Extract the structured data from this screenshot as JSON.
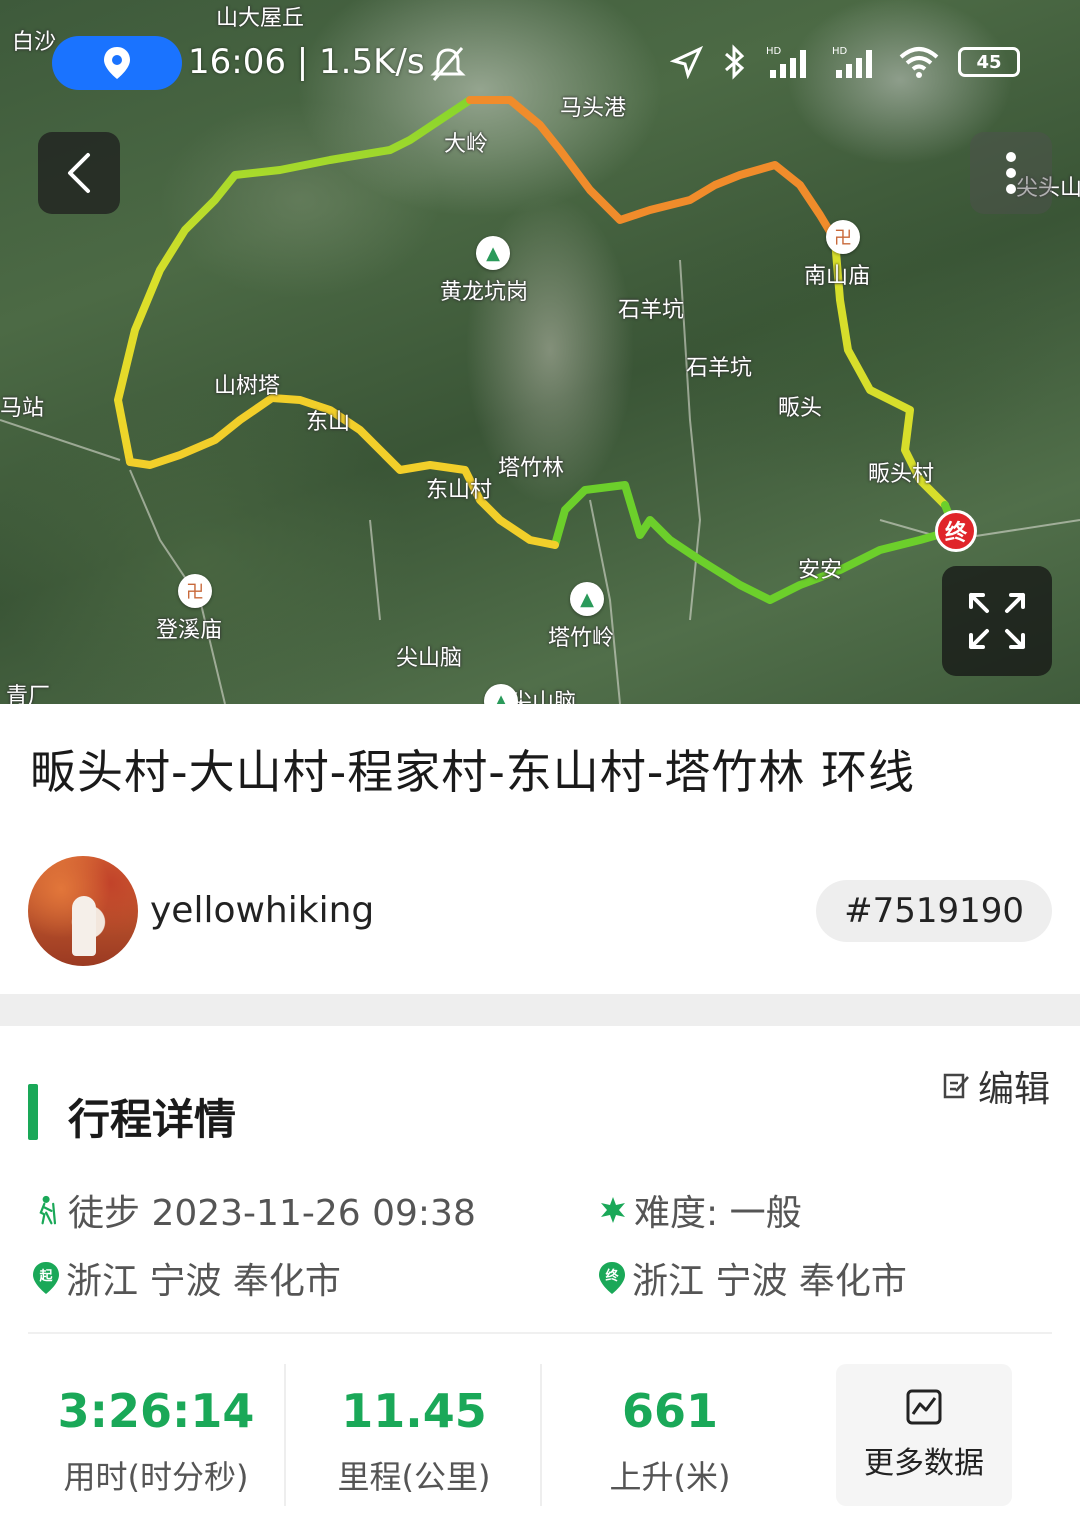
{
  "status_bar": {
    "time_speed": "16:06 | 1.5K/s",
    "battery": "45",
    "icons": [
      "location-icon",
      "mute-bell-icon",
      "navigation-arrow-icon",
      "bluetooth-icon",
      "signal-hd-icon",
      "signal-hd-icon",
      "wifi-icon",
      "battery-icon"
    ]
  },
  "map": {
    "labels": [
      "白沙",
      "山大屋丘",
      "大岭",
      "马头港",
      "黄龙坑岗",
      "石羊坑",
      "石羊坑",
      "南山庙",
      "畈头",
      "畈头村",
      "山树塔",
      "东山",
      "塔竹林",
      "东山村",
      "马站",
      "登溪庙",
      "塔竹岭",
      "尖山脑",
      "尖山脑",
      "青厂",
      "安安",
      "尖头山"
    ],
    "end_marker": "终",
    "route_colors": {
      "green": "#6bd12a",
      "yellow": "#f2e02a",
      "orange": "#f08a2a"
    }
  },
  "route": {
    "title": "畈头村-大山村-程家村-东山村-塔竹林 环线"
  },
  "user": {
    "name": "yellowhiking",
    "track_id": "#7519190"
  },
  "details": {
    "section_title": "行程详情",
    "edit_label": "编辑",
    "activity": "徒步 2023-11-26 09:38",
    "difficulty": "难度: 一般",
    "start_location": "浙江 宁波 奉化市",
    "end_location": "浙江 宁波 奉化市",
    "start_badge": "起",
    "end_badge": "终"
  },
  "stats": [
    {
      "value": "3:26:14",
      "label": "用时(时分秒)"
    },
    {
      "value": "11.45",
      "label": "里程(公里)"
    },
    {
      "value": "661",
      "label": "上升(米)"
    }
  ],
  "more_data_label": "更多数据",
  "colors": {
    "accent": "#1aa858",
    "status_pill": "#1a73ff",
    "end_marker": "#e0252a"
  }
}
